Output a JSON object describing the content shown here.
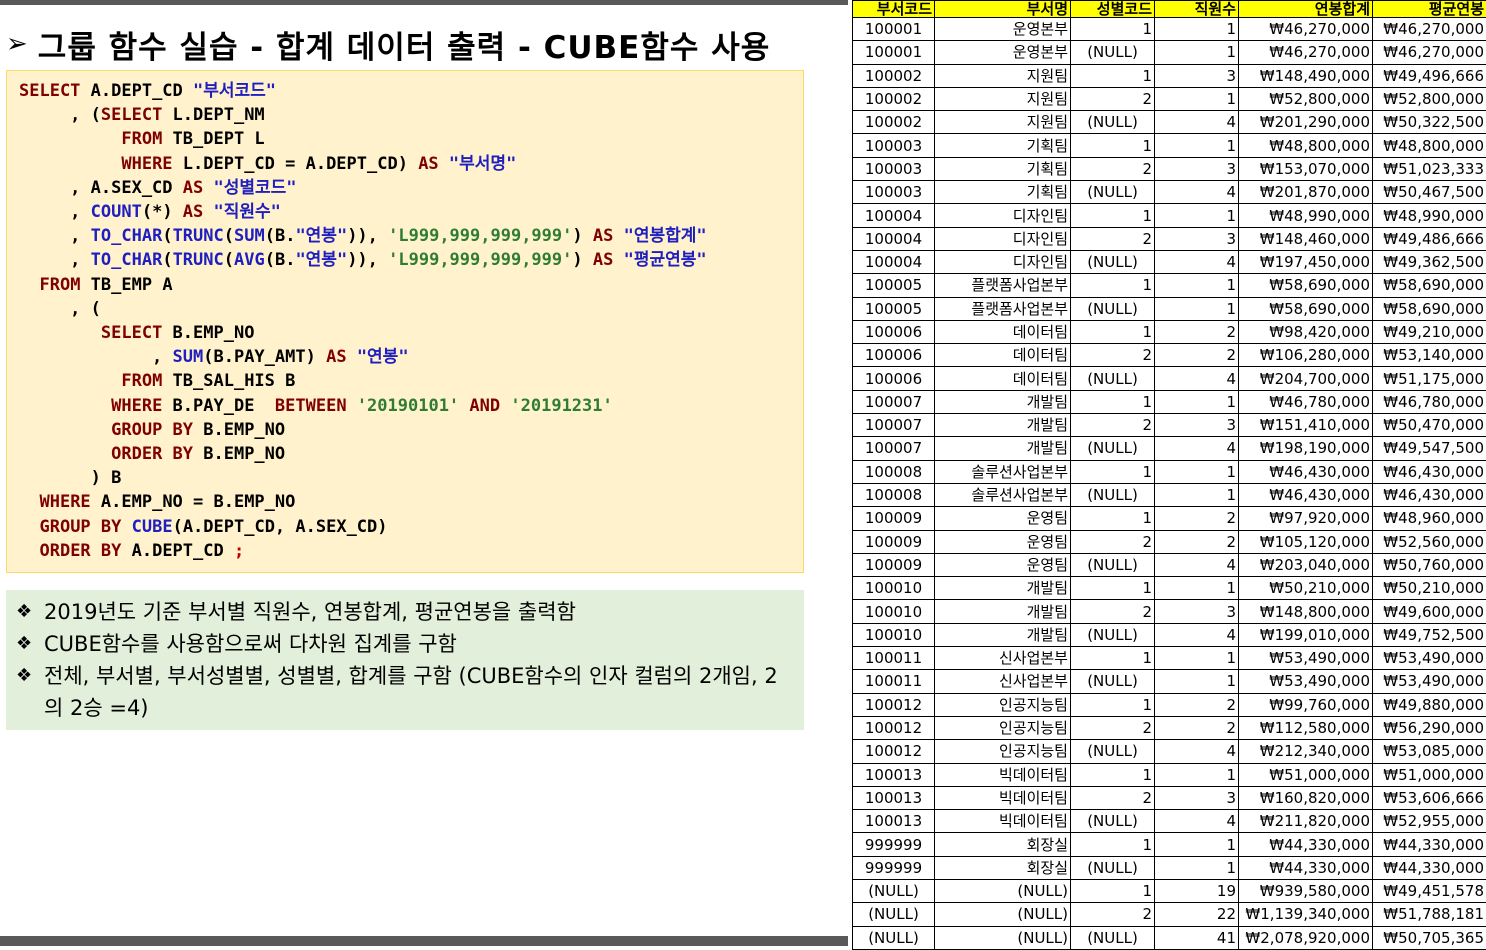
{
  "slide": {
    "bullet": "➢",
    "title": "그룹 함수 실습 - 합계 데이터 출력 - CUBE함수 사용"
  },
  "code": {
    "lines": [
      [
        "SELECT",
        " A.DEPT_CD ",
        "\"부서코드\""
      ],
      [
        "     , (",
        "SELECT",
        " L.DEPT_NM"
      ],
      [
        "          ",
        "FROM",
        " TB_DEPT L"
      ],
      [
        "          ",
        "WHERE",
        " L.DEPT_CD = A.DEPT_CD) ",
        "AS",
        " ",
        "\"부서명\""
      ],
      [
        "     , A.SEX_CD ",
        "AS",
        " ",
        "\"성별코드\""
      ],
      [
        "     , ",
        "COUNT",
        "(*) ",
        "AS",
        " ",
        "\"직원수\""
      ],
      [
        "     , ",
        "TO_CHAR",
        "(",
        "TRUNC",
        "(",
        "SUM",
        "(B.",
        "\"연봉\"",
        ")), ",
        "'L999,999,999,999'",
        ") ",
        "AS",
        " ",
        "\"연봉합계\""
      ],
      [
        "     , ",
        "TO_CHAR",
        "(",
        "TRUNC",
        "(",
        "AVG",
        "(B.",
        "\"연봉\"",
        ")), ",
        "'L999,999,999,999'",
        ") ",
        "AS",
        " ",
        "\"평균연봉\""
      ],
      [
        "  ",
        "FROM",
        " TB_EMP A"
      ],
      [
        "     , ("
      ],
      [
        "        ",
        "SELECT",
        " B.EMP_NO"
      ],
      [
        "             , ",
        "SUM",
        "(B.PAY_AMT) ",
        "AS",
        " ",
        "\"연봉\""
      ],
      [
        "          ",
        "FROM",
        " TB_SAL_HIS B"
      ],
      [
        "         ",
        "WHERE",
        " B.PAY_DE  ",
        "BETWEEN",
        " ",
        "'20190101'",
        " ",
        "AND",
        " ",
        "'20191231'"
      ],
      [
        "         ",
        "GROUP BY",
        " B.EMP_NO"
      ],
      [
        "         ",
        "ORDER BY",
        " B.EMP_NO"
      ],
      [
        "       ) B"
      ],
      [
        "  ",
        "WHERE",
        " A.EMP_NO = B.EMP_NO"
      ],
      [
        "  ",
        "GROUP BY",
        " ",
        "CUBE",
        "(A.DEPT_CD, A.SEX_CD)"
      ],
      [
        "  ",
        "ORDER BY",
        " A.DEPT_CD ",
        ";"
      ]
    ]
  },
  "notes": {
    "marker": "❖",
    "items": [
      "2019년도 기준 부서별 직원수, 연봉합계, 평균연봉을 출력함",
      "CUBE함수를 사용함으로써 다차원 집계를 구함",
      "전체, 부서별, 부서성별별, 성별별, 합계를 구함 (CUBE함수의 인자 컬럼의 2개임, 2의 2승 =4)"
    ]
  },
  "table": {
    "headers": [
      "부서코드",
      "부서명",
      "성별코드",
      "직원수",
      "연봉합계",
      "평균연봉"
    ],
    "rows": [
      [
        "100001",
        "운영본부",
        "1",
        "1",
        "₩46,270,000",
        "₩46,270,000"
      ],
      [
        "100001",
        "운영본부",
        "(NULL)",
        "1",
        "₩46,270,000",
        "₩46,270,000"
      ],
      [
        "100002",
        "지원팀",
        "1",
        "3",
        "₩148,490,000",
        "₩49,496,666"
      ],
      [
        "100002",
        "지원팀",
        "2",
        "1",
        "₩52,800,000",
        "₩52,800,000"
      ],
      [
        "100002",
        "지원팀",
        "(NULL)",
        "4",
        "₩201,290,000",
        "₩50,322,500"
      ],
      [
        "100003",
        "기획팀",
        "1",
        "1",
        "₩48,800,000",
        "₩48,800,000"
      ],
      [
        "100003",
        "기획팀",
        "2",
        "3",
        "₩153,070,000",
        "₩51,023,333"
      ],
      [
        "100003",
        "기획팀",
        "(NULL)",
        "4",
        "₩201,870,000",
        "₩50,467,500"
      ],
      [
        "100004",
        "디자인팀",
        "1",
        "1",
        "₩48,990,000",
        "₩48,990,000"
      ],
      [
        "100004",
        "디자인팀",
        "2",
        "3",
        "₩148,460,000",
        "₩49,486,666"
      ],
      [
        "100004",
        "디자인팀",
        "(NULL)",
        "4",
        "₩197,450,000",
        "₩49,362,500"
      ],
      [
        "100005",
        "플랫폼사업본부",
        "1",
        "1",
        "₩58,690,000",
        "₩58,690,000"
      ],
      [
        "100005",
        "플랫폼사업본부",
        "(NULL)",
        "1",
        "₩58,690,000",
        "₩58,690,000"
      ],
      [
        "100006",
        "데이터팀",
        "1",
        "2",
        "₩98,420,000",
        "₩49,210,000"
      ],
      [
        "100006",
        "데이터팀",
        "2",
        "2",
        "₩106,280,000",
        "₩53,140,000"
      ],
      [
        "100006",
        "데이터팀",
        "(NULL)",
        "4",
        "₩204,700,000",
        "₩51,175,000"
      ],
      [
        "100007",
        "개발팀",
        "1",
        "1",
        "₩46,780,000",
        "₩46,780,000"
      ],
      [
        "100007",
        "개발팀",
        "2",
        "3",
        "₩151,410,000",
        "₩50,470,000"
      ],
      [
        "100007",
        "개발팀",
        "(NULL)",
        "4",
        "₩198,190,000",
        "₩49,547,500"
      ],
      [
        "100008",
        "솔루션사업본부",
        "1",
        "1",
        "₩46,430,000",
        "₩46,430,000"
      ],
      [
        "100008",
        "솔루션사업본부",
        "(NULL)",
        "1",
        "₩46,430,000",
        "₩46,430,000"
      ],
      [
        "100009",
        "운영팀",
        "1",
        "2",
        "₩97,920,000",
        "₩48,960,000"
      ],
      [
        "100009",
        "운영팀",
        "2",
        "2",
        "₩105,120,000",
        "₩52,560,000"
      ],
      [
        "100009",
        "운영팀",
        "(NULL)",
        "4",
        "₩203,040,000",
        "₩50,760,000"
      ],
      [
        "100010",
        "개발팀",
        "1",
        "1",
        "₩50,210,000",
        "₩50,210,000"
      ],
      [
        "100010",
        "개발팀",
        "2",
        "3",
        "₩148,800,000",
        "₩49,600,000"
      ],
      [
        "100010",
        "개발팀",
        "(NULL)",
        "4",
        "₩199,010,000",
        "₩49,752,500"
      ],
      [
        "100011",
        "신사업본부",
        "1",
        "1",
        "₩53,490,000",
        "₩53,490,000"
      ],
      [
        "100011",
        "신사업본부",
        "(NULL)",
        "1",
        "₩53,490,000",
        "₩53,490,000"
      ],
      [
        "100012",
        "인공지능팀",
        "1",
        "2",
        "₩99,760,000",
        "₩49,880,000"
      ],
      [
        "100012",
        "인공지능팀",
        "2",
        "2",
        "₩112,580,000",
        "₩56,290,000"
      ],
      [
        "100012",
        "인공지능팀",
        "(NULL)",
        "4",
        "₩212,340,000",
        "₩53,085,000"
      ],
      [
        "100013",
        "빅데이터팀",
        "1",
        "1",
        "₩51,000,000",
        "₩51,000,000"
      ],
      [
        "100013",
        "빅데이터팀",
        "2",
        "3",
        "₩160,820,000",
        "₩53,606,666"
      ],
      [
        "100013",
        "빅데이터팀",
        "(NULL)",
        "4",
        "₩211,820,000",
        "₩52,955,000"
      ],
      [
        "999999",
        "회장실",
        "1",
        "1",
        "₩44,330,000",
        "₩44,330,000"
      ],
      [
        "999999",
        "회장실",
        "(NULL)",
        "1",
        "₩44,330,000",
        "₩44,330,000"
      ],
      [
        "(NULL)",
        "(NULL)",
        "1",
        "19",
        "₩939,580,000",
        "₩49,451,578"
      ],
      [
        "(NULL)",
        "(NULL)",
        "2",
        "22",
        "₩1,139,340,000",
        "₩51,788,181"
      ],
      [
        "(NULL)",
        "(NULL)",
        "(NULL)",
        "41",
        "₩2,078,920,000",
        "₩50,705,365"
      ]
    ]
  }
}
